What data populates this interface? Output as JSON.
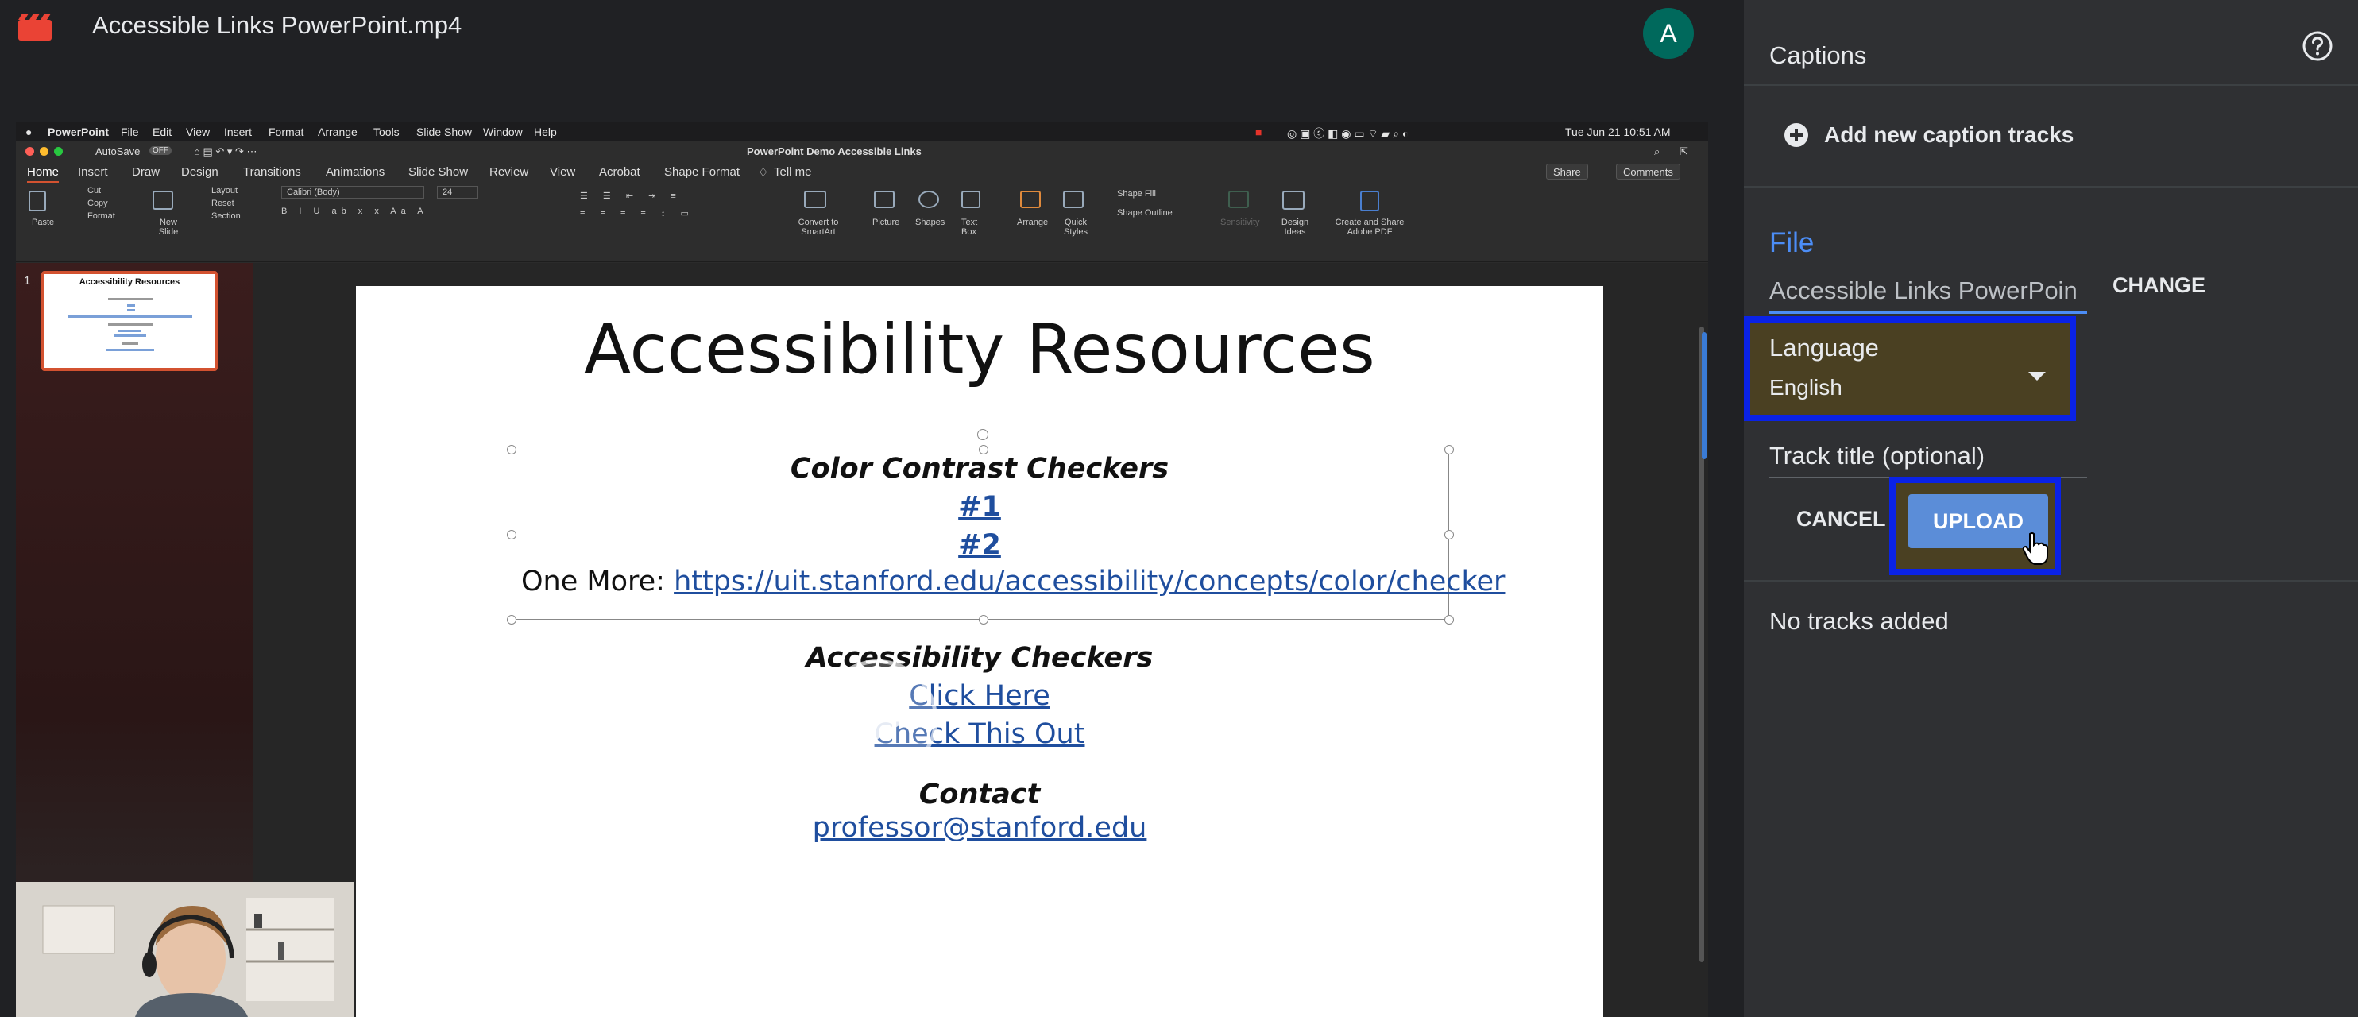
{
  "header": {
    "file_title": "Accessible Links PowerPoint.mp4",
    "avatar_initial": "A",
    "avatar_color": "#00695c"
  },
  "video": {
    "mac_menubar": {
      "app": "PowerPoint",
      "items": [
        "File",
        "Edit",
        "View",
        "Insert",
        "Format",
        "Arrange",
        "Tools",
        "Slide Show",
        "Window",
        "Help"
      ],
      "clock": "Tue Jun 21  10:51 AM"
    },
    "ppt_titlebar": {
      "autosave": "AutoSave",
      "autosave_state": "OFF",
      "document_title": "PowerPoint Demo Accessible Links"
    },
    "ppt_tabs": [
      "Home",
      "Insert",
      "Draw",
      "Design",
      "Transitions",
      "Animations",
      "Slide Show",
      "Review",
      "View",
      "Acrobat",
      "Shape Format",
      "Tell me"
    ],
    "ppt_buttons": {
      "share": "Share",
      "comments": "Comments"
    },
    "ribbon": {
      "paste": "Paste",
      "cut": "Cut",
      "copy": "Copy",
      "format": "Format",
      "new_slide": "New Slide",
      "layout": "Layout",
      "reset": "Reset",
      "section": "Section",
      "font_name": "Calibri (Body)",
      "font_size": "24",
      "convert_smartart": "Convert to SmartArt",
      "picture": "Picture",
      "shapes": "Shapes",
      "text_box": "Text Box",
      "arrange": "Arrange",
      "quick_styles": "Quick Styles",
      "shape_fill": "Shape Fill",
      "shape_outline": "Shape Outline",
      "sensitivity": "Sensitivity",
      "design_ideas": "Design Ideas",
      "create_share_pdf": "Create and Share Adobe PDF"
    },
    "thumbnail": {
      "slide_number": "1",
      "title": "Accessibility Resources"
    },
    "slide": {
      "title": "Accessibility Resources",
      "heading1": "Color Contrast Checkers",
      "link1": "#1",
      "link2": "#2",
      "one_more_prefix": "One More: ",
      "one_more_link": "https://uit.stanford.edu/accessibility/concepts/color/checker",
      "heading2": "Accessibility Checkers",
      "link3": "Click Here",
      "link4": "Check This Out",
      "heading3": "Contact",
      "email": "professor@stanford.edu"
    }
  },
  "captions_panel": {
    "title": "Captions",
    "help_icon": "help-circle-icon",
    "add_track_label": "Add new caption tracks",
    "file_heading": "File",
    "file_name": "Accessible Links PowerPoin",
    "change_label": "CHANGE",
    "language_label": "Language",
    "language_value": "English",
    "track_title_placeholder": "Track title (optional)",
    "cancel_label": "CANCEL",
    "upload_label": "UPLOAD",
    "no_tracks": "No tracks added",
    "highlight_color": "#0a22e6",
    "accent_color": "#4c8df6"
  }
}
